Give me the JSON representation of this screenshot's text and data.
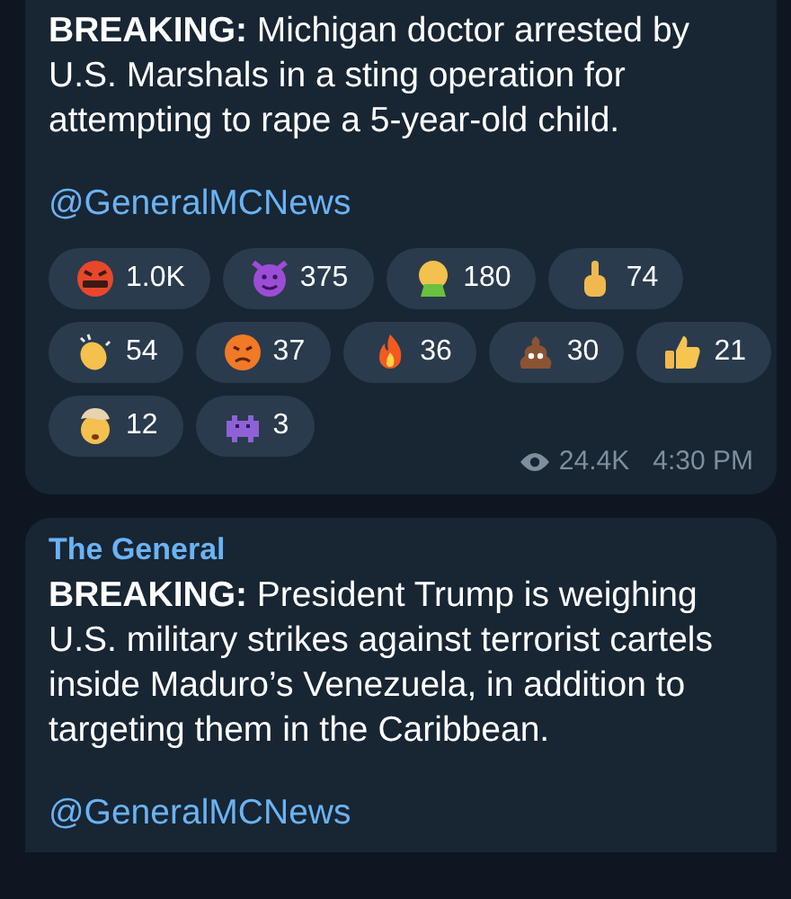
{
  "messages": [
    {
      "text": "**BREAKING:** Michigan doctor arrested by U.S. Marshals in a sting operation for attempting to rape a 5-year-old child.",
      "link": "@GeneralMCNews",
      "reactions": [
        {
          "count": "1.0K"
        },
        {
          "count": "375"
        },
        {
          "count": "180"
        },
        {
          "count": "74"
        },
        {
          "count": "54"
        },
        {
          "count": "37"
        },
        {
          "count": "36"
        },
        {
          "count": "30"
        },
        {
          "count": "21"
        },
        {
          "count": "12"
        },
        {
          "count": "3"
        }
      ],
      "views": "24.4K",
      "time": "4:30 PM"
    },
    {
      "sender": "The General",
      "text": "**BREAKING:** President Trump is weighing U.S. military strikes against terrorist cartels inside Maduro’s Venezuela, in addition to targeting them in the Caribbean.",
      "link": "@GeneralMCNews"
    }
  ]
}
